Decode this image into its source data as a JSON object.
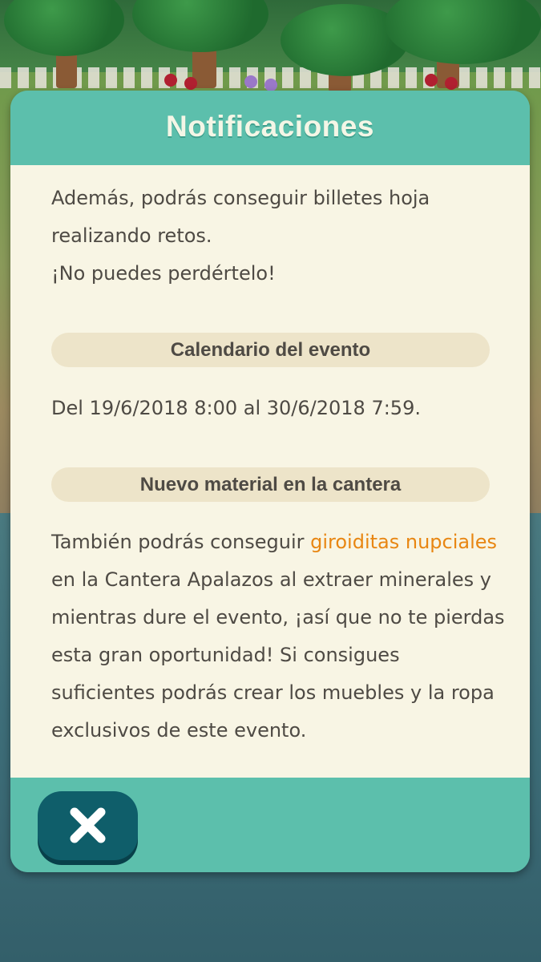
{
  "dialog": {
    "title": "Notificaciones",
    "intro_lines": [
      "Además, podrás conseguir billetes hoja",
      "realizando retos.",
      "¡No puedes perdértelo!"
    ],
    "sections": [
      {
        "heading": "Calendario del evento",
        "lines": [
          "Del 19/6/2018 8:00 al 30/6/2018 7:59."
        ]
      },
      {
        "heading": "Nuevo material en la cantera",
        "line1_prefix": "También podrás conseguir ",
        "line1_highlight": "giroiditas nupciales",
        "lines": [
          "en la Cantera Apalazos al extraer minerales y",
          "mientras dure el evento, ¡así que no te pierdas",
          "esta gran oportunidad! Si consigues",
          "suficientes podrás crear los muebles y la ropa",
          "exclusivos de este evento."
        ]
      }
    ],
    "close_icon": "close-x-icon"
  },
  "colors": {
    "header_teal": "#5cbfac",
    "body_cream": "#f8f5e4",
    "pill": "#ede4c9",
    "highlight_orange": "#e88612",
    "close_button": "#0f5e6a"
  }
}
